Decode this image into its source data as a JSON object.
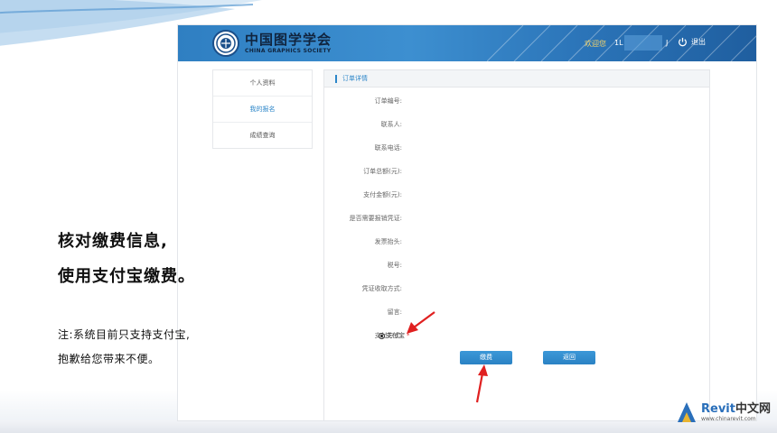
{
  "slide": {
    "headline_line1": "核对缴费信息,",
    "headline_line2": "使用支付宝缴费。",
    "note_line1": "注:系统目前只支持支付宝,",
    "note_line2": "抱歉给您带来不便。"
  },
  "site": {
    "logo": {
      "cn": "中国图学学会",
      "en": "CHINA GRAPHICS SOCIETY"
    },
    "header": {
      "welcome": "欢迎您",
      "username_start": "1L",
      "username_end": "J",
      "logout_label": "退出"
    },
    "sidebar": {
      "items": [
        {
          "label": "个人资料",
          "active": false
        },
        {
          "label": "我的报名",
          "active": true
        },
        {
          "label": "成绩查询",
          "active": false
        }
      ]
    },
    "panel": {
      "title": "订单详情",
      "fields": [
        {
          "label": "订单编号:",
          "value": ""
        },
        {
          "label": "联系人:",
          "value": ""
        },
        {
          "label": "联系电话:",
          "value": ""
        },
        {
          "label": "订单总额(元):",
          "value": ""
        },
        {
          "label": "支付金额(元):",
          "value": ""
        },
        {
          "label": "是否需要报销凭证:",
          "value": ""
        },
        {
          "label": "发票抬头:",
          "value": ""
        },
        {
          "label": "税号:",
          "value": ""
        },
        {
          "label": "凭证收取方式:",
          "value": ""
        },
        {
          "label": "留言:",
          "value": ""
        }
      ],
      "payment_label": "支付方式:",
      "payment_option": "支付宝",
      "required_mark": "*",
      "pay_button": "缴费",
      "back_button": "返回"
    }
  },
  "watermark": {
    "brand": "Revit",
    "brand_suffix": "中文网",
    "url": "www.chinarevit.com"
  },
  "colors": {
    "header_blue": "#2f7fc2",
    "accent_blue": "#2c86c9",
    "button_blue": "#2a82c4",
    "arrow_red": "#e02020",
    "welcome_gold": "#f3d36a"
  }
}
